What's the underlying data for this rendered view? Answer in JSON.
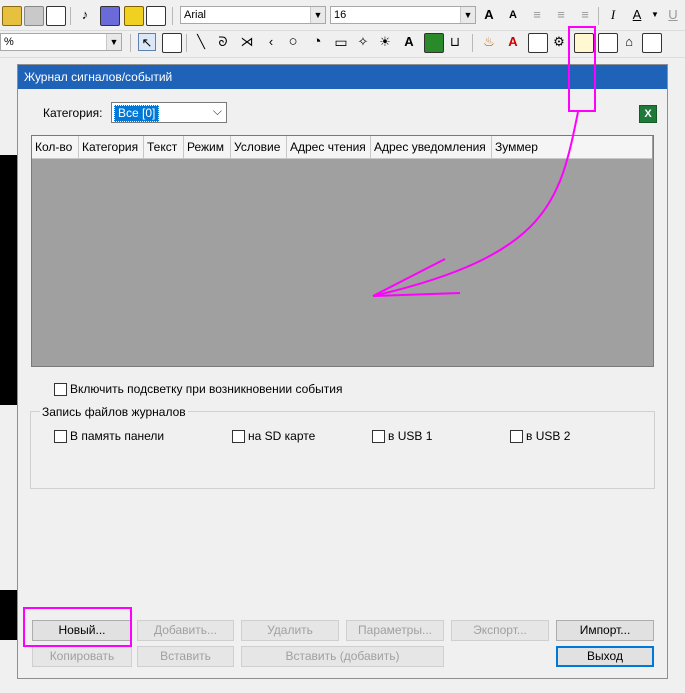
{
  "toolbar1": {
    "font_name": "Arial",
    "font_size": "16",
    "icons": [
      "new-icon",
      "open-icon",
      "save-icon",
      "music-icon",
      "compile-icon",
      "comment-icon",
      "edit-icon"
    ],
    "format_icons": [
      "grow-font-icon",
      "shrink-font-icon",
      "align-left-icon",
      "align-center-icon",
      "align-right-icon",
      "italic-icon",
      "font-color-icon",
      "underline-icon"
    ]
  },
  "toolbar2": {
    "zoom_value": "%",
    "tools": [
      "pointer-icon",
      "properties-icon",
      "line-icon",
      "polyline-icon",
      "arc-icon",
      "curve-icon",
      "circle-icon",
      "pie-icon",
      "rectangle-icon",
      "star-icon",
      "text-icon",
      "bitmap-icon",
      "frame-icon",
      "tag-icon",
      "alarm-text-icon",
      "data-icon",
      "recipe-icon",
      "event-log-icon",
      "schedule-icon",
      "calendar-icon"
    ]
  },
  "dialog": {
    "title": "Журнал сигналов/событий",
    "category_label": "Категория:",
    "category_value": "Все [0]",
    "columns": [
      "Кол-во",
      "Категория",
      "Текст",
      "Режим",
      "Условие",
      "Адрес чтения",
      "Адрес уведомления",
      "Зуммер"
    ],
    "highlight_checkbox": "Включить подсветку при возникновении события",
    "group_title": "Запись файлов журналов",
    "storage_options": [
      "В память панели",
      "на SD карте",
      "в USB 1",
      "в USB 2"
    ],
    "buttons_row1": {
      "new": "Новый...",
      "add": "Добавить...",
      "delete": "Удалить",
      "params": "Параметры...",
      "export": "Экспорт...",
      "import": "Импорт..."
    },
    "buttons_row2": {
      "copy": "Копировать",
      "paste": "Вставить",
      "paste_add": "Вставить (добавить)",
      "exit": "Выход"
    }
  },
  "colors": {
    "title_bar": "#1e63b8",
    "grid_bg": "#a0a0a0",
    "annotation": "#ff00ff"
  }
}
